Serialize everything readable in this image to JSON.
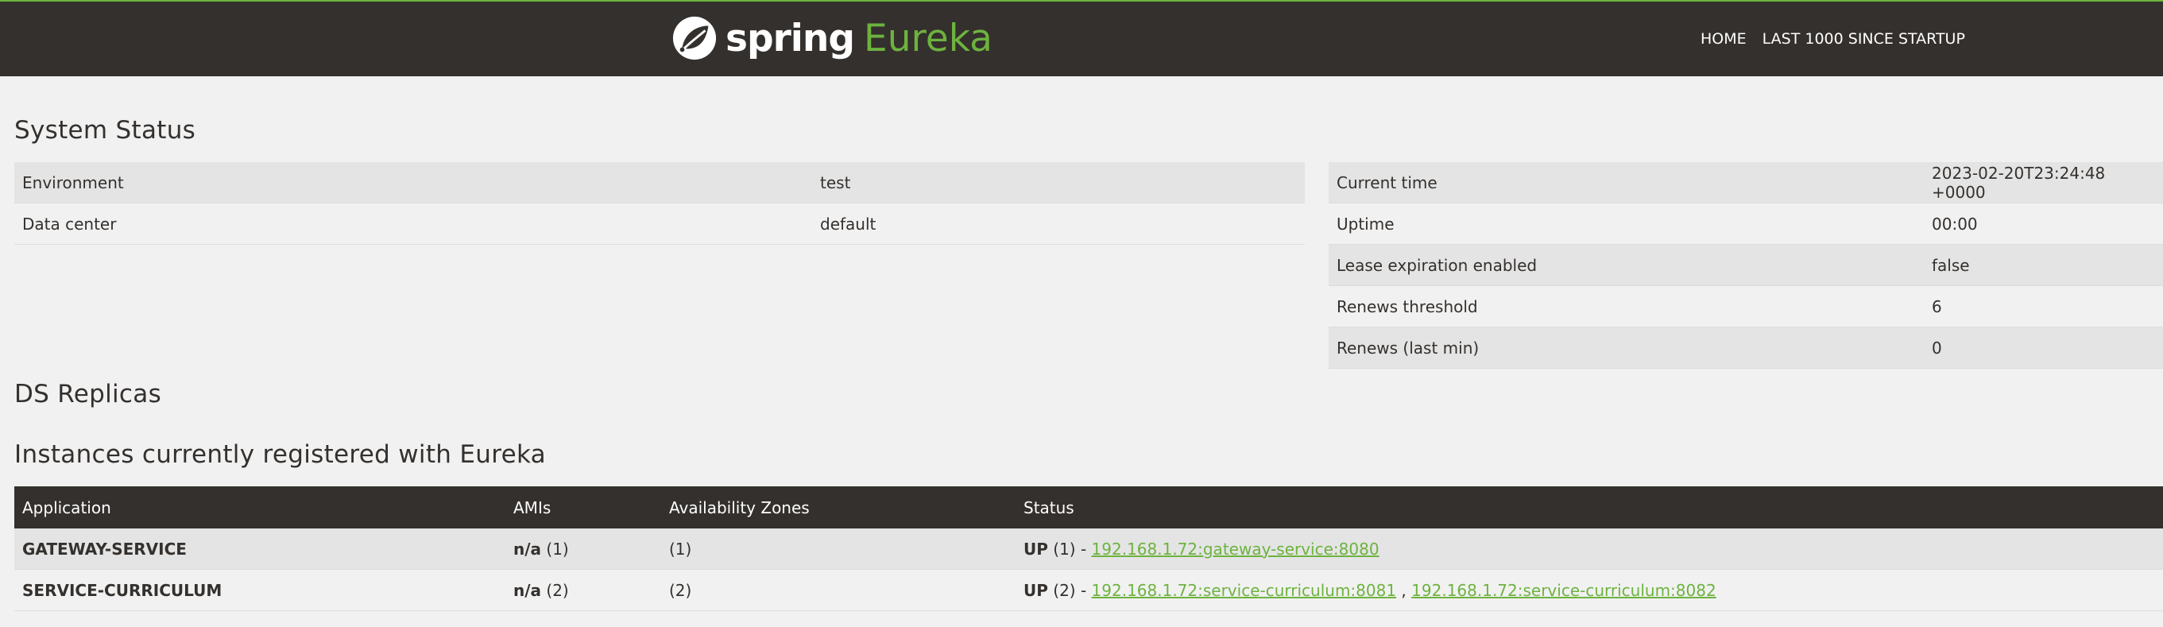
{
  "brand": {
    "word": "spring",
    "product": "Eureka"
  },
  "nav": {
    "home": "HOME",
    "last1000": "LAST 1000 SINCE STARTUP"
  },
  "system_status": {
    "title": "System Status",
    "left": [
      {
        "label": "Environment",
        "value": "test"
      },
      {
        "label": "Data center",
        "value": "default"
      }
    ],
    "right": [
      {
        "label": "Current time",
        "value": "2023-02-20T23:24:48 +0000"
      },
      {
        "label": "Uptime",
        "value": "00:00"
      },
      {
        "label": "Lease expiration enabled",
        "value": "false"
      },
      {
        "label": "Renews threshold",
        "value": "6"
      },
      {
        "label": "Renews (last min)",
        "value": "0"
      }
    ]
  },
  "ds_replicas": {
    "title": "DS Replicas"
  },
  "instances": {
    "title": "Instances currently registered with Eureka",
    "headers": [
      "Application",
      "AMIs",
      "Availability Zones",
      "Status"
    ],
    "rows": [
      {
        "application": "GATEWAY-SERVICE",
        "amis_bold": "n/a",
        "amis_count": " (1)",
        "zones": "(1)",
        "status_prefix_bold": "UP",
        "status_prefix_rest": " (1) - ",
        "links": [
          "192.168.1.72:gateway-service:8080"
        ],
        "separator": ""
      },
      {
        "application": "SERVICE-CURRICULUM",
        "amis_bold": "n/a",
        "amis_count": " (2)",
        "zones": "(2)",
        "status_prefix_bold": "UP",
        "status_prefix_rest": " (2) - ",
        "links": [
          "192.168.1.72:service-curriculum:8081",
          "192.168.1.72:service-curriculum:8082"
        ],
        "separator": " , "
      }
    ]
  },
  "colors": {
    "accent": "#6db33f",
    "dark": "#34302d",
    "row_alt": "#e4e4e4",
    "background": "#f1f1f1"
  }
}
